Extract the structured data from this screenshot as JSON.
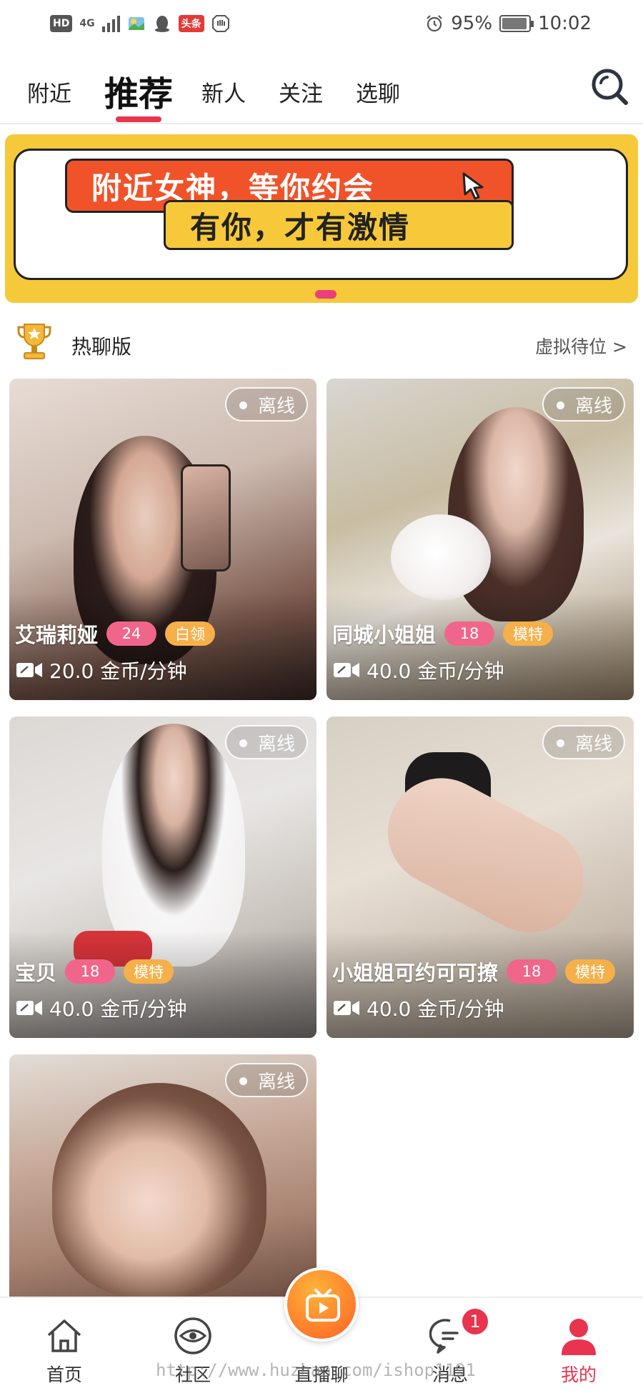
{
  "status_bar": {
    "hd": "HD",
    "network": "4G",
    "news_chip": "头条",
    "battery": "95%",
    "time": "10:02"
  },
  "top_tabs": [
    {
      "label": "附近",
      "active": false
    },
    {
      "label": "推荐",
      "active": true
    },
    {
      "label": "新人",
      "active": false
    },
    {
      "label": "关注",
      "active": false
    },
    {
      "label": "选聊",
      "active": false
    }
  ],
  "banner": {
    "line1": "附近女神，等你约会",
    "line2": "有你，才有激情",
    "colors": {
      "background": "#f6c93a",
      "bubble_top": "#f0532a",
      "bubble_bottom": "#f7c93a",
      "dot": "#ec3f78"
    }
  },
  "section": {
    "title": "热聊版",
    "link": "虚拟待位 >"
  },
  "cards": [
    {
      "name": "艾瑞莉娅",
      "age": "24",
      "tag": "白领",
      "status": "离线",
      "price": "20.0 金币/分钟"
    },
    {
      "name": "同城小姐姐",
      "age": "18",
      "tag": "模特",
      "status": "离线",
      "price": "40.0 金币/分钟"
    },
    {
      "name": "宝贝",
      "age": "18",
      "tag": "模特",
      "status": "离线",
      "price": "40.0 金币/分钟"
    },
    {
      "name": "小姐姐可约可可撩",
      "age": "18",
      "tag": "模特",
      "status": "离线",
      "price": "40.0 金币/分钟"
    },
    {
      "name": "",
      "age": "",
      "tag": "",
      "status": "离线",
      "price": ""
    }
  ],
  "bottom_nav": [
    {
      "label": "首页",
      "icon": "home-icon",
      "active": false
    },
    {
      "label": "社区",
      "icon": "community-icon",
      "active": false
    },
    {
      "label": "直播聊",
      "icon": "live-tv-icon",
      "active": false
    },
    {
      "label": "消息",
      "icon": "message-icon",
      "active": false,
      "badge": "1"
    },
    {
      "label": "我的",
      "icon": "profile-icon",
      "active": true
    }
  ],
  "watermark": "http://www.huzhan.com/ishop1191",
  "colors": {
    "accent": "#e8344e",
    "age_badge": "#f0668a",
    "tag_badge": "#f6b04a"
  }
}
